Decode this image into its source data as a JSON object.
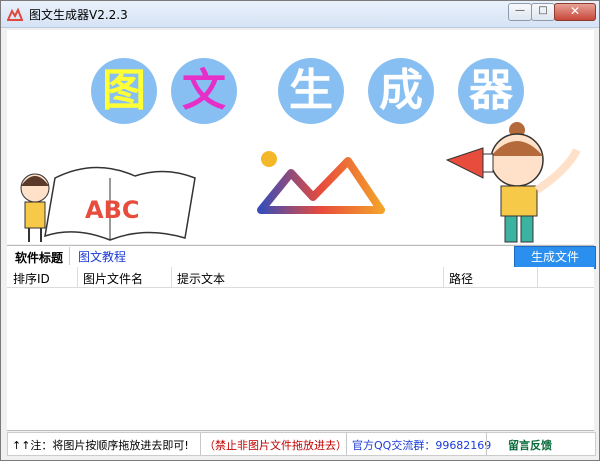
{
  "window": {
    "title": "图文生成器V2.2.3",
    "min_icon": "minimize-icon",
    "max_icon": "maximize-icon",
    "close_icon": "close-icon",
    "close_glyph": "✕",
    "min_glyph": "—",
    "max_glyph": "□"
  },
  "banner": {
    "chars": [
      "图",
      "文",
      "生",
      "成",
      "器"
    ],
    "char_colors": [
      "#ffff33",
      "#e62ec8",
      "#ffffff",
      "#ffffff",
      "#ffffff"
    ],
    "abc": "ABC"
  },
  "form": {
    "label": "软件标题",
    "value": "图文教程",
    "generate_button": "生成文件"
  },
  "table": {
    "columns": [
      "排序ID",
      "图片文件名",
      "提示文本",
      "路径"
    ],
    "rows": []
  },
  "status": {
    "hint": "↑↑注：将图片按顺序拖放进去即可!",
    "warning": "（禁止非图片文件拖放进去）",
    "qq_group": "官方QQ交流群：99682169",
    "feedback": "留言反馈"
  },
  "colors": {
    "accent": "#2b8ff0",
    "bubble": "#88bff3",
    "warning_red": "#c00000",
    "qq_blue": "#1a3bd6",
    "feedback_green": "#0a6b3a"
  }
}
